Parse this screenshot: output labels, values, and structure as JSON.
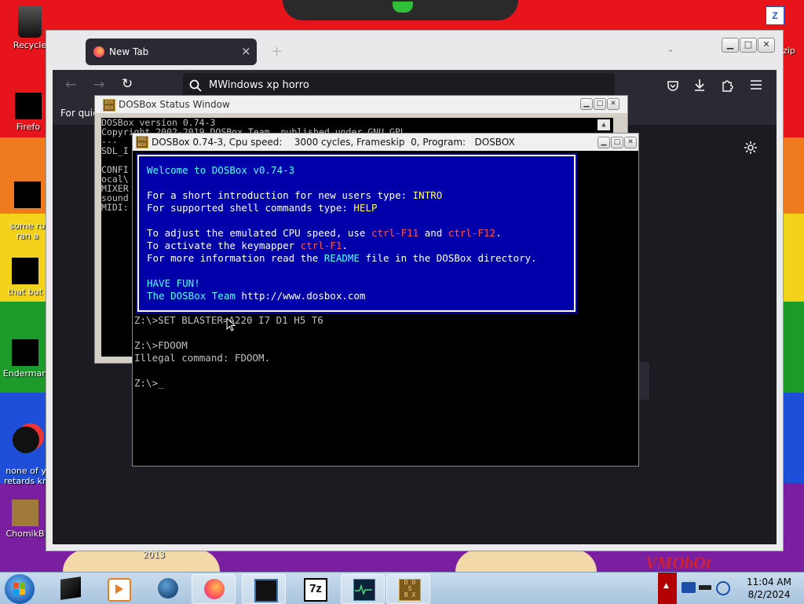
{
  "desktop": {
    "icons": [
      {
        "label": "Recycle"
      },
      {
        "label": "Firefo"
      },
      {
        "label": "some ru\nran a"
      },
      {
        "label": "that but"
      },
      {
        "label": "Enderman"
      },
      {
        "label": "none of y\nretards kn"
      },
      {
        "label": "ChomikB"
      }
    ],
    "right_icon_label": "zip",
    "bottom_year": "2013",
    "watermark": "VMObOt"
  },
  "browser": {
    "tab_title": "New Tab",
    "tab_close": "×",
    "new_tab_symbol": "+",
    "url_value": "MWindows xp horro",
    "bookmarks_text": "For quic"
  },
  "status_window": {
    "title": "DOSBox Status Window",
    "lines": [
      "DOSBox version 0.74-3",
      "Copyright 2002-2019 DOSBox Team, published under GNU GPL.",
      "---",
      "SDL_I",
      "",
      "CONFI",
      "ocal\\",
      "MIXER",
      "sound",
      "MIDI:"
    ]
  },
  "dosbox": {
    "title": "DOSBox 0.74-3, Cpu speed:    3000 cycles, Frameskip  0, Program:   DOSBOX",
    "welcome": {
      "heading": "Welcome to DOSBox v0.74-3",
      "intro_pre": "For a short introduction for new users type: ",
      "intro_cmd": "INTRO",
      "help_pre": "For supported shell commands type: ",
      "help_cmd": "HELP",
      "cpu_pre": "To adjust the emulated CPU speed, use ",
      "cpu_k1": "ctrl-F11",
      "cpu_mid": " and ",
      "cpu_k2": "ctrl-F12",
      "cpu_end": ".",
      "map_pre": "To activate the keymapper ",
      "map_k": "ctrl-F1",
      "map_end": ".",
      "info_pre": "For more information read the ",
      "info_readme": "README",
      "info_post": " file in the DOSBox directory.",
      "fun": "HAVE FUN!",
      "team_pre": "The DOSBox Team ",
      "team_url": "http://www.dosbox.com"
    },
    "terminal": [
      "Z:\\>SET BLASTER=A220 I7 D1 H5 T6",
      "",
      "Z:\\>FDOOM",
      "Illegal command: FDOOM.",
      "",
      "Z:\\>_"
    ]
  },
  "taskbar": {
    "time": "11:04 AM",
    "date": "8/2/2024",
    "sevenzip_label": "7z"
  },
  "colors": {
    "dos_blue": "#0000aa",
    "dos_cyan": "#55ffff",
    "dos_red": "#ff5555",
    "firefox_dark": "#2b2a33"
  }
}
